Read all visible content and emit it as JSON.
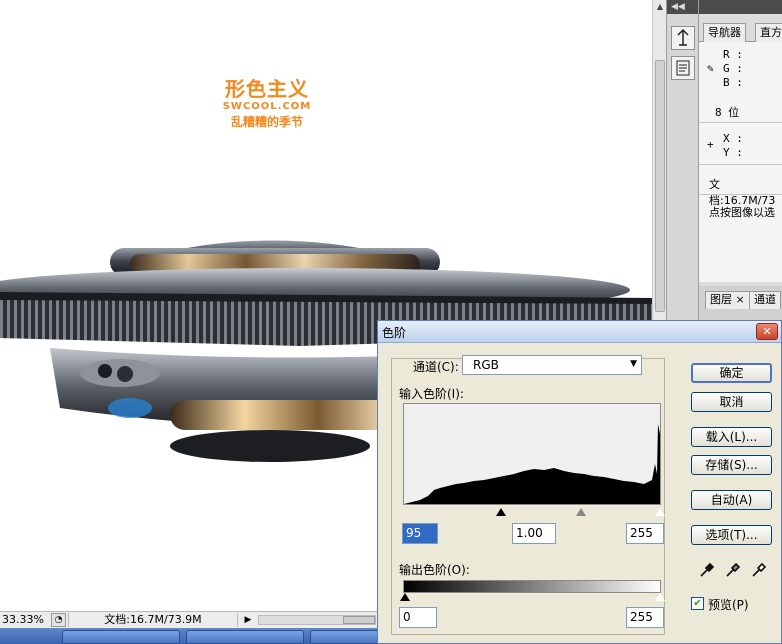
{
  "logo": {
    "line1": "形色主义",
    "line2": "SWCOOL.COM",
    "line3": "乱糟糟的季节"
  },
  "statusbar": {
    "zoom": "33.33%",
    "doc": "文档:16.7M/73.9M"
  },
  "info_panel": {
    "tabs": [
      "导航器",
      "直方"
    ],
    "rgb_labels": [
      "R :",
      "G :",
      "B :"
    ],
    "bit_depth": "8 位",
    "xy_labels": [
      "X :",
      "Y :"
    ],
    "doc": "文档:16.7M/73",
    "hint": "点按图像以选"
  },
  "layers_tabs": [
    "图层",
    "通道"
  ],
  "levels_dialog": {
    "title": "色阶",
    "channel_label": "通道(C):",
    "channel_value": "RGB",
    "input_levels_label": "输入色阶(I):",
    "input_black": "95",
    "input_gamma": "1.00",
    "input_white": "255",
    "output_levels_label": "输出色阶(O):",
    "output_black": "0",
    "output_white": "255",
    "buttons": {
      "ok": "确定",
      "cancel": "取消",
      "load": "载入(L)...",
      "save": "存储(S)...",
      "auto": "自动(A)",
      "options": "选项(T)..."
    },
    "preview_label": "预览(P)",
    "preview_checked": true
  },
  "colors": {
    "accent_logo": "#f0891e",
    "dialog_bg": "#ece9d8",
    "taskbar": "#3a64b1"
  }
}
